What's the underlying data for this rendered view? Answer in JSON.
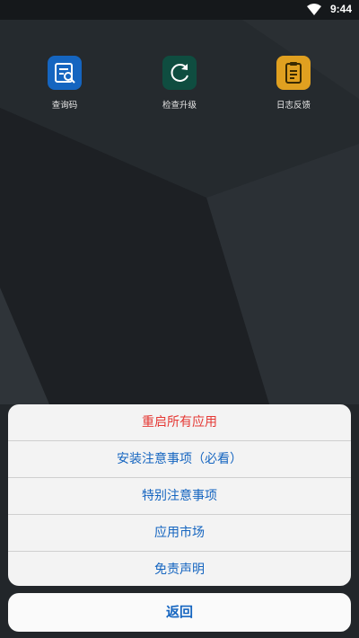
{
  "status_bar": {
    "time": "9:44",
    "wifi_icon": "wifi-icon"
  },
  "apps": [
    {
      "label": "查询码",
      "icon": "search-document-icon",
      "color": "#1565c0"
    },
    {
      "label": "检查升级",
      "icon": "refresh-icon",
      "color": "#0f4d40"
    },
    {
      "label": "日志反馈",
      "icon": "clipboard-icon",
      "color": "#e0a020"
    }
  ],
  "action_sheet": {
    "items": [
      "重启所有应用",
      "安装注意事项（必看）",
      "特别注意事项",
      "应用市场",
      "免责声明"
    ],
    "destructive_color": "#e53935",
    "accent_color": "#1565c0",
    "cancel_label": "返回"
  }
}
